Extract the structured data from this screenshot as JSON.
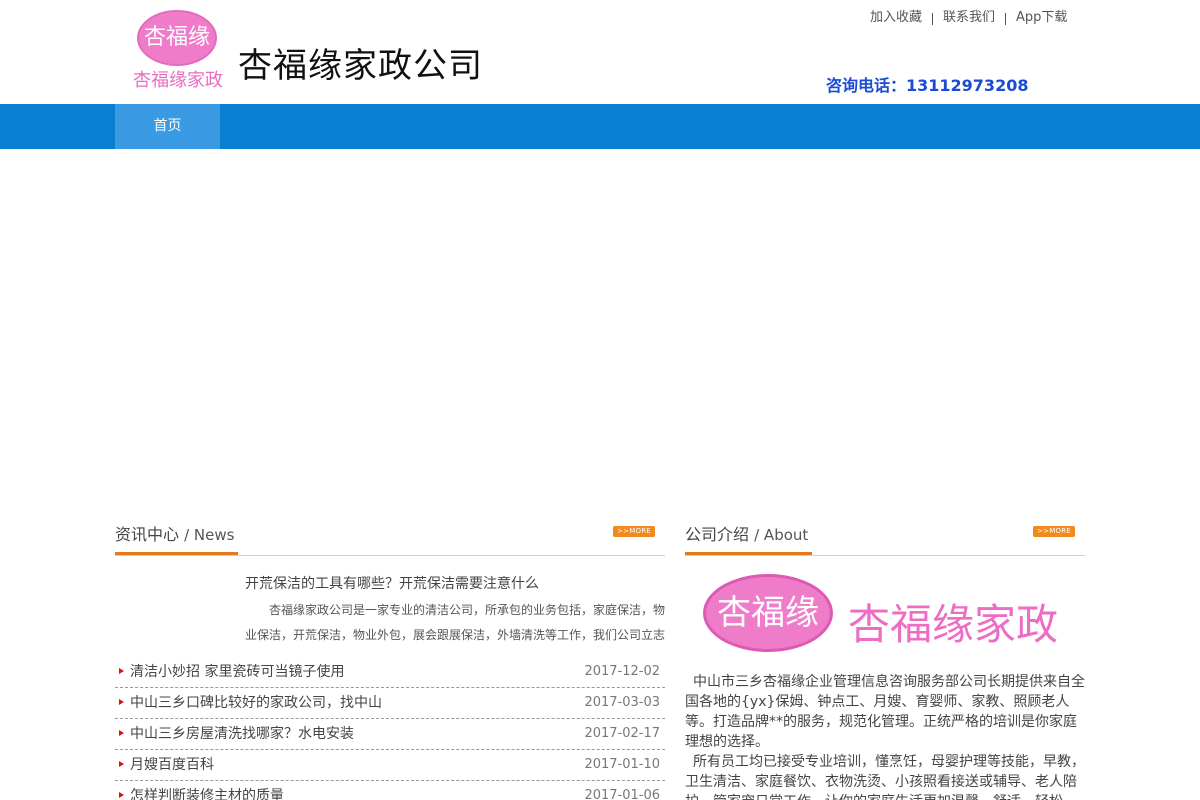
{
  "header": {
    "logo_badge_text": "杏福缘",
    "logo_sub_text": "杏福缘家政",
    "site_title": "杏福缘家政公司",
    "top_links": [
      "加入收藏",
      "联系我们",
      "App下载"
    ],
    "hotline": "咨询电话：13112973208"
  },
  "nav": {
    "items": [
      {
        "label": "首页"
      }
    ]
  },
  "news": {
    "title_cn": "资讯中心",
    "title_en": "/ News",
    "more_label": ">>MORE",
    "featured": {
      "title": "开荒保洁的工具有哪些？开荒保洁需要注意什么",
      "desc": "杏福缘家政公司是一家专业的清洁公司，所承包的业务包括，家庭保洁，物业保洁，开荒保洁，物业外包，展会跟展保洁，外墙清洗等工作，我们公司立志"
    },
    "items": [
      {
        "title": "清洁小妙招 家里瓷砖可当镜子使用",
        "date": "2017-12-02"
      },
      {
        "title": "中山三乡口碑比较好的家政公司，找中山",
        "date": "2017-03-03"
      },
      {
        "title": "中山三乡房屋清洗找哪家？水电安装",
        "date": "2017-02-17"
      },
      {
        "title": "月嫂百度百科",
        "date": "2017-01-10"
      },
      {
        "title": "怎样判断装修主材的质量",
        "date": "2017-01-06"
      }
    ]
  },
  "about": {
    "title_cn": "公司介绍",
    "title_en": "/ About",
    "more_label": ">>MORE",
    "logo_badge_text": "杏福缘",
    "logo_text": "杏福缘家政",
    "paragraphs": [
      "中山市三乡杏福缘企业管理信息咨询服务部公司长期提供来自全国各地的{yx}保姆、钟点工、月嫂、育婴师、家教、照顾老人等。打造品牌**的服务，规范化管理。正统严格的培训是你家庭理想的选择。",
      "所有员工均已接受专业培训，懂烹饪，母婴护理等技能，早教，卫生清洁、家庭餐饮、衣物洗烫、小孩照看接送或辅导、老人陪护、管家宠日常工作，让你的家庭生活更加温馨、舒适、轻松。"
    ]
  },
  "colors": {
    "nav_bg": "#0a7fd2",
    "nav_active": "#3a9ae3",
    "accent_orange": "#e77a1e",
    "hotline_blue": "#1a4bd6",
    "logo_pink": "#ee7cc9"
  }
}
